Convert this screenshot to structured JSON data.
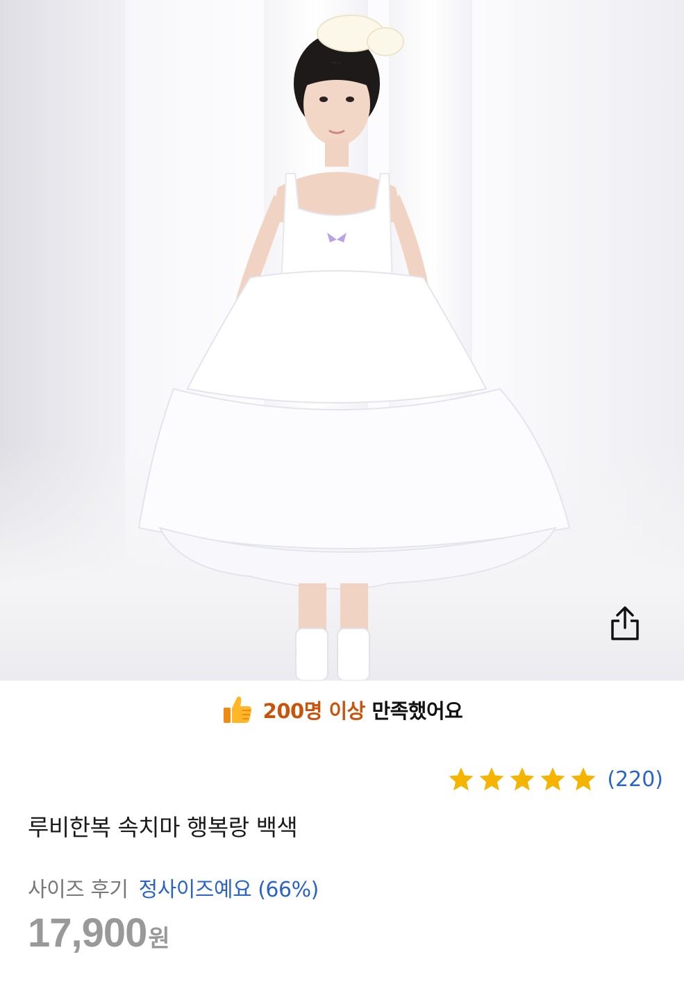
{
  "product": {
    "image_alt": "product photo",
    "satisfaction": {
      "highlight": "200명 이상",
      "rest": "만족했어요"
    },
    "rating": {
      "stars": 5,
      "review_count": "(220)"
    },
    "title": "루비한복 속치마 행복랑 백색",
    "size_review": {
      "label": "사이즈 후기",
      "value": "정사이즈예요 (66%)"
    },
    "price": {
      "amount": "17,900",
      "unit": "원"
    }
  },
  "icons": {
    "share": "share-icon",
    "thumb": "thumbs-up-icon",
    "star": "star-icon"
  },
  "colors": {
    "accent_orange": "#c9530a",
    "link_blue": "#2b64c9",
    "star_yellow": "#f5b400",
    "price_gray": "#999999"
  }
}
